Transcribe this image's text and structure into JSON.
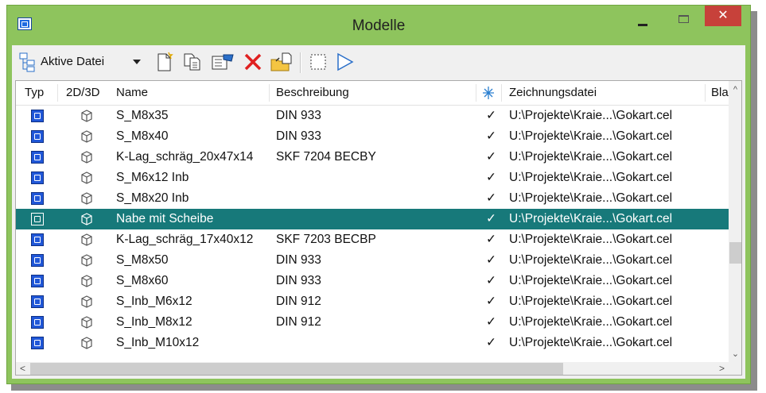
{
  "window": {
    "title": "Modelle",
    "close_glyph": "✕"
  },
  "toolbar": {
    "scope_label": "Aktive Datei",
    "icons": [
      "models-tree-icon",
      "new-model-icon",
      "copy-model-icon",
      "properties-icon",
      "delete-icon",
      "import-icon",
      "select-icon",
      "arrow-right-icon"
    ]
  },
  "columns": {
    "typ": "Typ",
    "dim": "2D/3D",
    "name": "Name",
    "beschreibung": "Beschreibung",
    "zeichnungsdatei": "Zeichnungsdatei",
    "blatt": "Bla"
  },
  "rows": [
    {
      "name": "S_M8x35",
      "beschreibung": "DIN 933",
      "check": "✓",
      "datei": "U:\\Projekte\\Kraie...\\Gokart.cel",
      "selected": false
    },
    {
      "name": "S_M8x40",
      "beschreibung": "DIN 933",
      "check": "✓",
      "datei": "U:\\Projekte\\Kraie...\\Gokart.cel",
      "selected": false
    },
    {
      "name": "K-Lag_schräg_20x47x14",
      "beschreibung": "SKF 7204 BECBY",
      "check": "✓",
      "datei": "U:\\Projekte\\Kraie...\\Gokart.cel",
      "selected": false
    },
    {
      "name": "S_M6x12 Inb",
      "beschreibung": "",
      "check": "✓",
      "datei": "U:\\Projekte\\Kraie...\\Gokart.cel",
      "selected": false
    },
    {
      "name": "S_M8x20 Inb",
      "beschreibung": "",
      "check": "✓",
      "datei": "U:\\Projekte\\Kraie...\\Gokart.cel",
      "selected": false
    },
    {
      "name": "Nabe mit Scheibe",
      "beschreibung": "",
      "check": "✓",
      "datei": "U:\\Projekte\\Kraie...\\Gokart.cel",
      "selected": true
    },
    {
      "name": "K-Lag_schräg_17x40x12",
      "beschreibung": "SKF 7203 BECBP",
      "check": "✓",
      "datei": "U:\\Projekte\\Kraie...\\Gokart.cel",
      "selected": false
    },
    {
      "name": "S_M8x50",
      "beschreibung": "DIN 933",
      "check": "✓",
      "datei": "U:\\Projekte\\Kraie...\\Gokart.cel",
      "selected": false
    },
    {
      "name": "S_M8x60",
      "beschreibung": "DIN 933",
      "check": "✓",
      "datei": "U:\\Projekte\\Kraie...\\Gokart.cel",
      "selected": false
    },
    {
      "name": "S_Inb_M6x12",
      "beschreibung": "DIN 912",
      "check": "✓",
      "datei": "U:\\Projekte\\Kraie...\\Gokart.cel",
      "selected": false
    },
    {
      "name": "S_Inb_M8x12",
      "beschreibung": "DIN 912",
      "check": "✓",
      "datei": "U:\\Projekte\\Kraie...\\Gokart.cel",
      "selected": false
    },
    {
      "name": "S_Inb_M10x12",
      "beschreibung": "",
      "check": "✓",
      "datei": "U:\\Projekte\\Kraie...\\Gokart.cel",
      "selected": false
    }
  ],
  "scroll": {
    "up": "^",
    "down": "⌄",
    "left": "<",
    "right": ">"
  },
  "colors": {
    "frame": "#8ec45d",
    "selection": "#17797a",
    "close": "#c7413a",
    "type_icon": "#2057d8"
  }
}
